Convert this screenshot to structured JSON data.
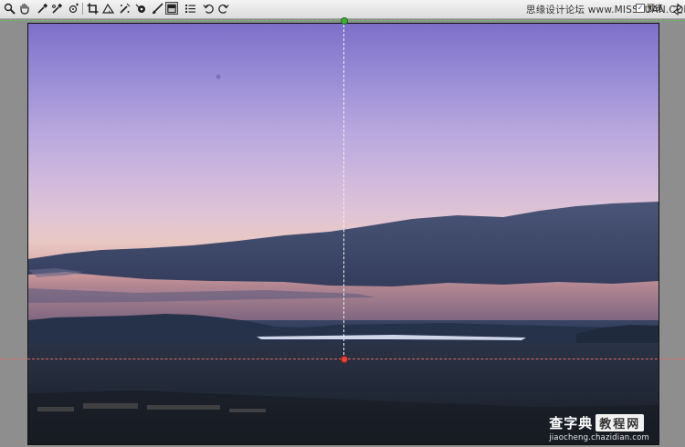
{
  "toolbar": {
    "tools": [
      {
        "name": "zoom-tool",
        "icon": "magnifier-icon"
      },
      {
        "name": "hand-tool",
        "icon": "hand-icon"
      },
      {
        "name": "white-balance-tool",
        "icon": "eyedropper-icon"
      },
      {
        "name": "color-sampler-tool",
        "icon": "color-sampler-icon"
      },
      {
        "name": "target-adjustment-tool",
        "icon": "target-adjust-icon"
      },
      {
        "name": "crop-tool",
        "icon": "crop-icon"
      },
      {
        "name": "straighten-tool",
        "icon": "straighten-icon"
      },
      {
        "name": "spot-removal-tool",
        "icon": "spot-removal-icon"
      },
      {
        "name": "red-eye-tool",
        "icon": "red-eye-icon"
      },
      {
        "name": "adjustment-brush-tool",
        "icon": "brush-icon"
      },
      {
        "name": "graduated-filter-tool",
        "icon": "graduated-filter-icon"
      },
      {
        "name": "preferences-tool",
        "icon": "list-icon"
      },
      {
        "name": "rotate-left-tool",
        "icon": "rotate-ccw-icon"
      },
      {
        "name": "rotate-right-tool",
        "icon": "rotate-cw-icon"
      }
    ],
    "watermark": "思缘设计论坛 www.MISSYUAN.COM",
    "preview_label": "预览",
    "preview_checked": true
  },
  "watermark": {
    "main": "查字典",
    "box": "教程网",
    "url": "jiaocheng.chazidian.com"
  },
  "colors": {
    "guide_red": "#e06a5c",
    "guide_green": "#6bbf5c",
    "dot_red": "#e8463a",
    "dot_green": "#3fae3a"
  }
}
